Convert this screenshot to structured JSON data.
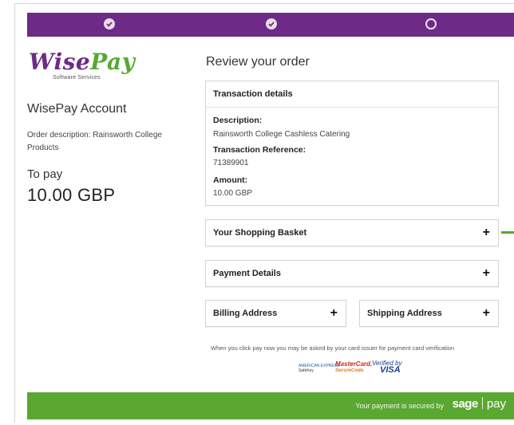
{
  "progress": {
    "steps": [
      {
        "state": "complete",
        "icon": "check-icon"
      },
      {
        "state": "complete",
        "icon": "check-icon"
      },
      {
        "state": "current",
        "icon": "circle-icon"
      }
    ]
  },
  "brand": {
    "logo_main_1": "Wi",
    "logo_main_2": "se",
    "logo_main_3": "Pay",
    "logo_sub": "Software Services",
    "purple": "#6d2a86",
    "green": "#5aa832"
  },
  "account": {
    "title": "WisePay Account",
    "order_description": "Order description: Rainsworth College Products",
    "to_pay_label": "To pay",
    "to_pay_value": "10.00 GBP"
  },
  "review": {
    "title": "Review your order",
    "transaction": {
      "heading": "Transaction details",
      "description_label": "Description:",
      "description_value": "Rainsworth College Cashless Catering",
      "reference_label": "Transaction Reference:",
      "reference_value": "71389901",
      "amount_label": "Amount:",
      "amount_value": "10.00 GBP"
    },
    "sections": {
      "basket": "Your Shopping Basket",
      "payment": "Payment Details",
      "billing": "Billing Address",
      "shipping": "Shipping Address",
      "expand_symbol": "+"
    },
    "verification_note": "When you click pay now you may be asked by your card issuer for payment card verification",
    "badges": {
      "amex_line1": "AMERICAN EXPRESS",
      "amex_line2": "SafeKey",
      "mastercard_line1": "MasterCard.",
      "mastercard_line2": "SecureCode.",
      "visa_line1": "Verified by",
      "visa_line2": "VISA"
    }
  },
  "footer": {
    "secured_text": "Your payment is secured by",
    "sage_word": "sage",
    "pay_word": "pay"
  }
}
